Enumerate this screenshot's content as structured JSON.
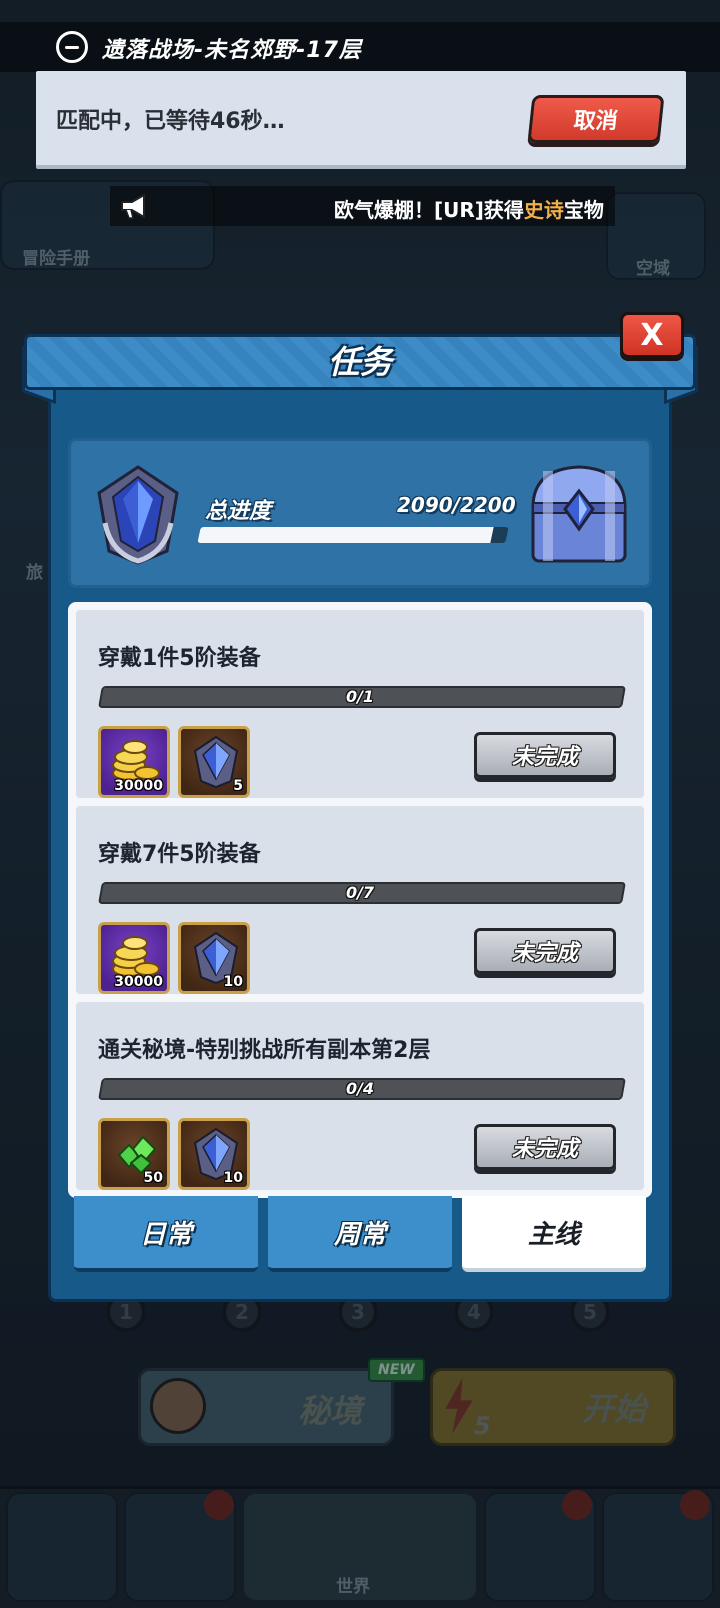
{
  "header": {
    "stage_title": "遗落战场-未名郊野-17层",
    "matching_text": "匹配中，已等待46秒…",
    "cancel_label": "取消"
  },
  "broadcast": {
    "prefix": "欧气爆棚！[UR]获得",
    "highlight": "史诗",
    "suffix": "宝物"
  },
  "background": {
    "adventure_manual": "冒险手册",
    "airspace": "空域",
    "travel": "旅",
    "secret_realm": "秘境",
    "new_badge": "NEW",
    "energy": "5",
    "start": "开始",
    "world": "世界",
    "stages": [
      "1",
      "2",
      "3",
      "4",
      "5"
    ]
  },
  "modal": {
    "title": "任务",
    "close_label": "X",
    "total_progress": {
      "label": "总进度",
      "current": 2090,
      "max": 2200,
      "text": "2090/2200"
    },
    "tasks": [
      {
        "name": "穿戴1件5阶装备",
        "progress": "0/1",
        "rewards": [
          {
            "icon": "gold-coins-icon",
            "qty": "30000",
            "frame": "purple"
          },
          {
            "icon": "blue-crystal-emblem-icon",
            "qty": "5",
            "frame": "brown"
          }
        ],
        "status": "未完成"
      },
      {
        "name": "穿戴7件5阶装备",
        "progress": "0/7",
        "rewards": [
          {
            "icon": "gold-coins-icon",
            "qty": "30000",
            "frame": "purple"
          },
          {
            "icon": "blue-crystal-emblem-icon",
            "qty": "10",
            "frame": "brown"
          }
        ],
        "status": "未完成"
      },
      {
        "name": "通关秘境-特别挑战所有副本第2层",
        "progress": "0/4",
        "rewards": [
          {
            "icon": "green-gems-icon",
            "qty": "50",
            "frame": "brown"
          },
          {
            "icon": "blue-crystal-emblem-icon",
            "qty": "10",
            "frame": "brown"
          }
        ],
        "status": "未完成"
      }
    ],
    "tabs": [
      {
        "label": "日常",
        "active": false
      },
      {
        "label": "周常",
        "active": false
      },
      {
        "label": "主线",
        "active": true
      }
    ]
  },
  "colors": {
    "panel": "#175a8a",
    "cancel_red": "#d23a2c",
    "epic_orange": "#f2b04a"
  }
}
